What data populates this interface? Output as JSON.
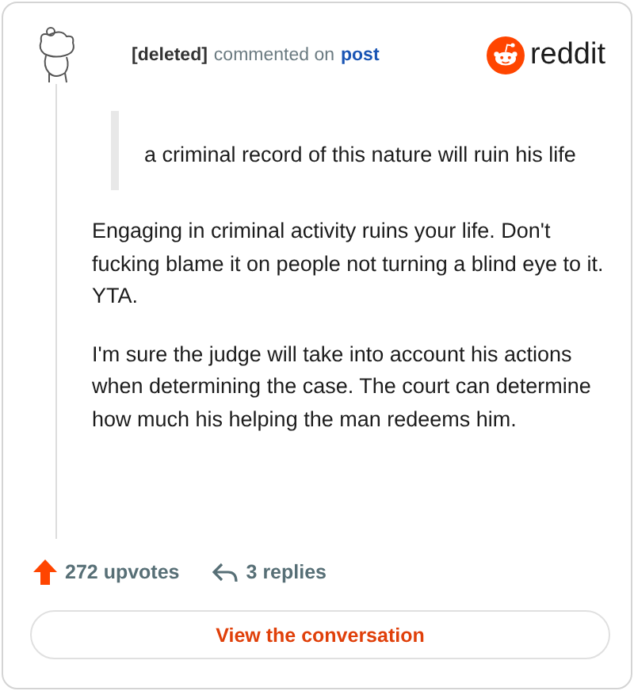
{
  "header": {
    "author": "[deleted]",
    "action": "commented on",
    "link": "post",
    "brand": "reddit"
  },
  "quote": "a criminal record of this nature will ruin his life",
  "paragraphs": [
    "Engaging in criminal activity ruins your life. Don't fucking blame it on people not turning a blind eye to it. YTA.",
    "I'm sure the judge will take into account his actions when determining the case. The court can determine how much his helping the man redeems him."
  ],
  "stats": {
    "upvotes": "272 upvotes",
    "replies": "3 replies"
  },
  "button": "View the conversation"
}
